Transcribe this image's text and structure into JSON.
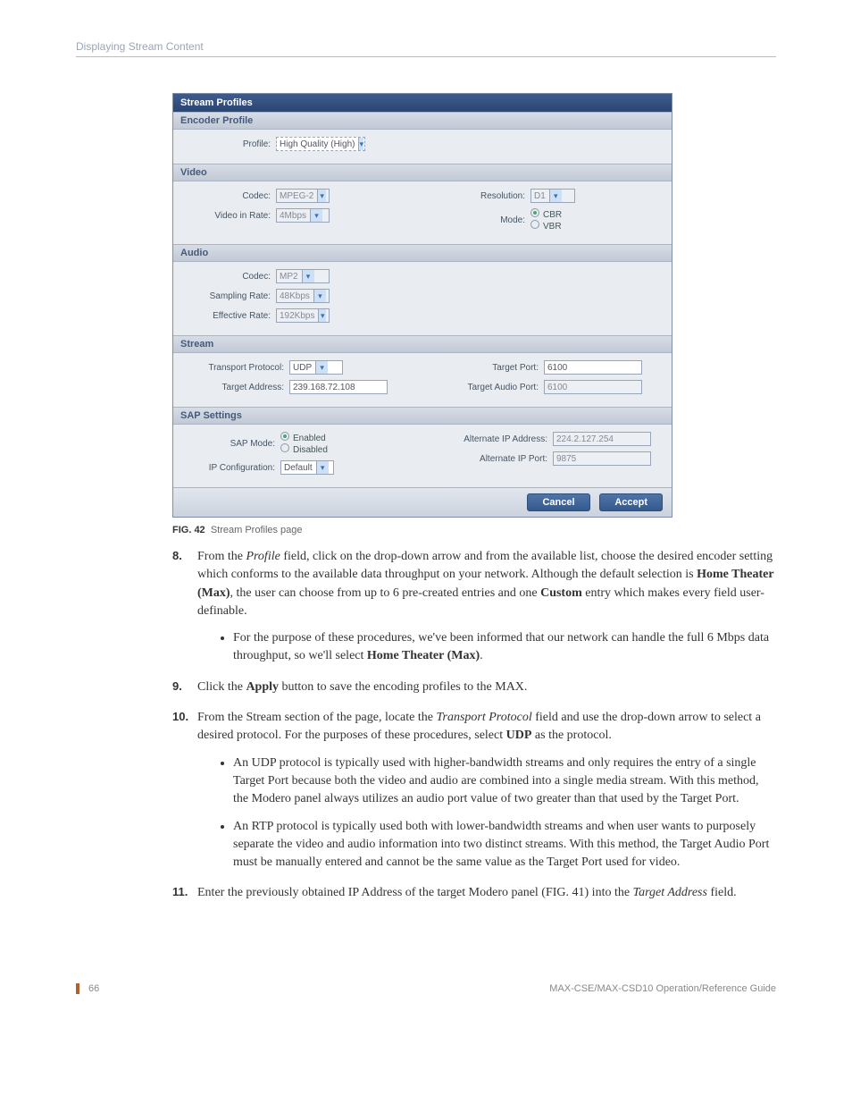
{
  "header": {
    "breadcrumb": "Displaying Stream Content"
  },
  "panel": {
    "title": "Stream Profiles",
    "encoder": {
      "heading": "Encoder Profile",
      "profile_label": "Profile:",
      "profile_value": "High Quality (High)"
    },
    "video": {
      "heading": "Video",
      "codec_label": "Codec:",
      "codec_value": "MPEG-2",
      "rate_label": "Video in Rate:",
      "rate_value": "4Mbps",
      "resolution_label": "Resolution:",
      "resolution_value": "D1",
      "mode_label": "Mode:",
      "mode_cbr": "CBR",
      "mode_vbr": "VBR"
    },
    "audio": {
      "heading": "Audio",
      "codec_label": "Codec:",
      "codec_value": "MP2",
      "sampling_label": "Sampling Rate:",
      "sampling_value": "48Kbps",
      "effective_label": "Effective Rate:",
      "effective_value": "192Kbps"
    },
    "stream": {
      "heading": "Stream",
      "transport_label": "Transport Protocol:",
      "transport_value": "UDP",
      "targetaddr_label": "Target Address:",
      "targetaddr_value": "239.168.72.108",
      "targetport_label": "Target Port:",
      "targetport_value": "6100",
      "targetaudport_label": "Target Audio Port:",
      "targetaudport_value": "6100"
    },
    "sap": {
      "heading": "SAP Settings",
      "mode_label": "SAP Mode:",
      "enabled": "Enabled",
      "disabled": "Disabled",
      "ipconfig_label": "IP Configuration:",
      "ipconfig_value": "Default",
      "altip_label": "Alternate IP Address:",
      "altip_value": "224.2.127.254",
      "altport_label": "Alternate IP Port:",
      "altport_value": "9875"
    },
    "buttons": {
      "cancel": "Cancel",
      "accept": "Accept"
    }
  },
  "figcaption": {
    "num": "FIG. 42",
    "text": "Stream Profiles page"
  },
  "steps": {
    "s8": {
      "num": "8.",
      "text_a": "From the ",
      "text_b_i": "Profile",
      "text_c": " field, click on the drop-down arrow and from the available list, choose the desired encoder setting which conforms to the available data throughput on your network. Although the default selection is ",
      "text_d_b": "Home Theater (Max)",
      "text_e": ", the user can choose from up to 6 pre-created entries and one ",
      "text_f_b": "Custom",
      "text_g": " entry which makes every field user-definable.",
      "bullet1_a": "For the purpose of these procedures, we've been informed that our network can handle the full 6 Mbps data throughput, so we'll select ",
      "bullet1_b": "Home Theater (Max)",
      "bullet1_c": "."
    },
    "s9": {
      "num": "9.",
      "text_a": "Click the ",
      "text_b_b": "Apply",
      "text_c": " button to save the encoding profiles to the MAX."
    },
    "s10": {
      "num": "10.",
      "text_a": "From the Stream section of the page, locate the ",
      "text_b_i": "Transport Protocol",
      "text_c": " field and use the drop-down arrow to select a desired protocol. For the purposes of these procedures, select ",
      "text_d_b": "UDP",
      "text_e": " as the protocol.",
      "bullet1": "An UDP protocol is typically used with higher-bandwidth streams and only requires the entry of a single Target Port because both the video and audio are combined into a single media stream. With this method, the Modero panel always utilizes an audio port value of two greater than that used by the Target Port.",
      "bullet2": "An RTP protocol is typically used both with lower-bandwidth streams and when user wants to purposely separate the video and audio information into two distinct streams. With this method, the Target Audio Port must be manually entered and cannot be the same value as the Target Port used for video."
    },
    "s11": {
      "num": "11.",
      "text_a": "Enter the previously obtained IP Address of the target Modero panel (FIG. 41) into the ",
      "text_b_i": "Target Address",
      "text_c": " field."
    }
  },
  "footer": {
    "pagenum": "66",
    "doc": "MAX-CSE/MAX-CSD10 Operation/Reference Guide"
  }
}
